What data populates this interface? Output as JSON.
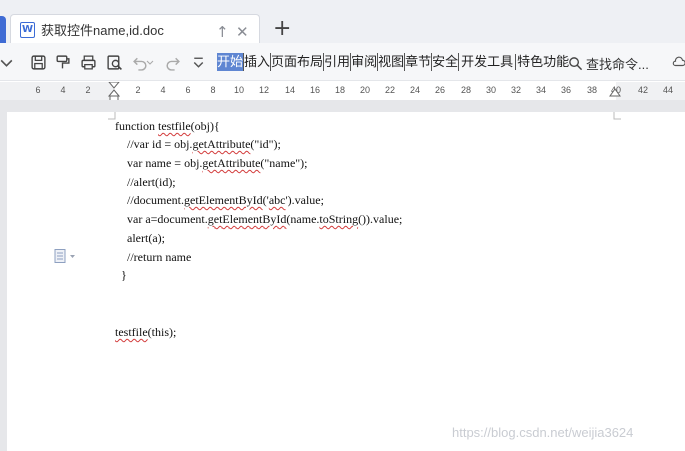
{
  "tab": {
    "icon_letter": "W",
    "title": "获取控件name,id.doc",
    "up_symbol": "↑",
    "close_symbol": "✕",
    "new_symbol": "+"
  },
  "toolbar": {
    "icons": [
      "save-icon",
      "format-painter-icon",
      "print-icon",
      "print-preview-icon",
      "undo-icon",
      "redo-icon",
      "more-icon"
    ],
    "menu": [
      "开始",
      "插入",
      "页面布局",
      "引用",
      "审阅",
      "视图",
      "章节",
      "安全",
      "开发工具",
      "特色功能"
    ],
    "active_menu": "开始",
    "search_label": "查找命令..."
  },
  "ruler": {
    "ticks": [
      "6",
      "4",
      "2",
      "2",
      "4",
      "6",
      "8",
      "10",
      "12",
      "14",
      "16",
      "18",
      "20",
      "22",
      "24",
      "26",
      "28",
      "30",
      "32",
      "34",
      "36",
      "38",
      "40",
      "42",
      "44"
    ]
  },
  "document": {
    "lines": [
      "function testfile(obj){",
      "//var id = obj.getAttribute(\"id\");",
      "var name = obj.getAttribute(\"name\");",
      "//alert(id);",
      "//document.getElementById('abc').value;",
      "var a=document.getElementById(name.toString()).value;",
      "alert(a);",
      "//return name",
      "}",
      "testfile(this);"
    ]
  },
  "watermark": "https://blog.csdn.net/weijia3624",
  "colors": {
    "accent": "#3c6cd6",
    "active_menu_bg": "#5f86d2",
    "squiggle": "#d23a3a"
  }
}
